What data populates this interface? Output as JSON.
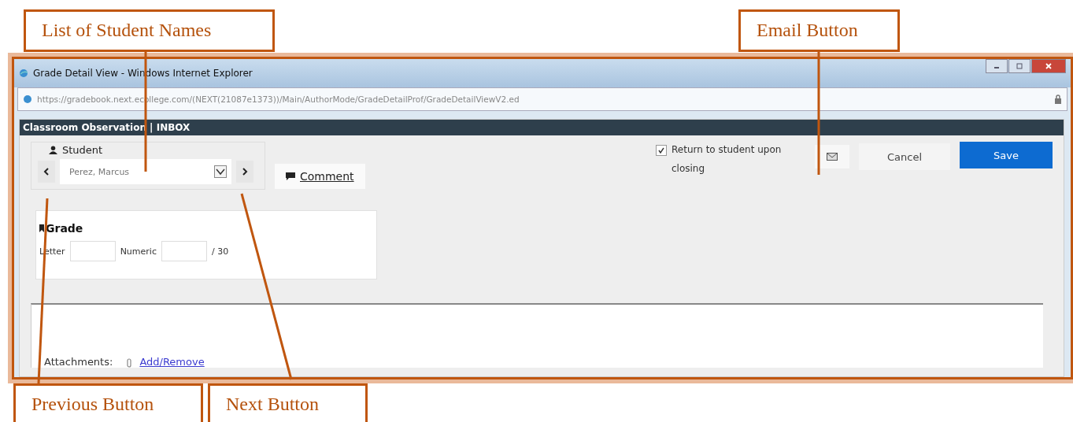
{
  "callouts": [
    {
      "label": "List of Student Names"
    },
    {
      "label": "Email Button"
    },
    {
      "label": "Previous Button"
    },
    {
      "label": "Next Button"
    }
  ],
  "window": {
    "title": "Grade Detail View - Windows Internet Explorer",
    "address": "https://gradebook.next.ecollege.com/(NEXT(21087e1373))/Main/AuthorMode/GradeDetailProf/GradeDetailViewV2.ed"
  },
  "page": {
    "header": "Classroom Observation | INBOX",
    "student": {
      "legend": "Student",
      "name": "Perez, Marcus"
    },
    "comment": "Comment",
    "return_option": {
      "label": "Return to student upon closing",
      "checked": true
    },
    "buttons": {
      "cancel": "Cancel",
      "save": "Save"
    },
    "grade": {
      "title": "Grade",
      "letter_label": "Letter",
      "numeric_label": "Numeric",
      "max": "/ 30"
    },
    "attachments": {
      "label": "Attachments:",
      "link": "Add/Remove"
    }
  }
}
